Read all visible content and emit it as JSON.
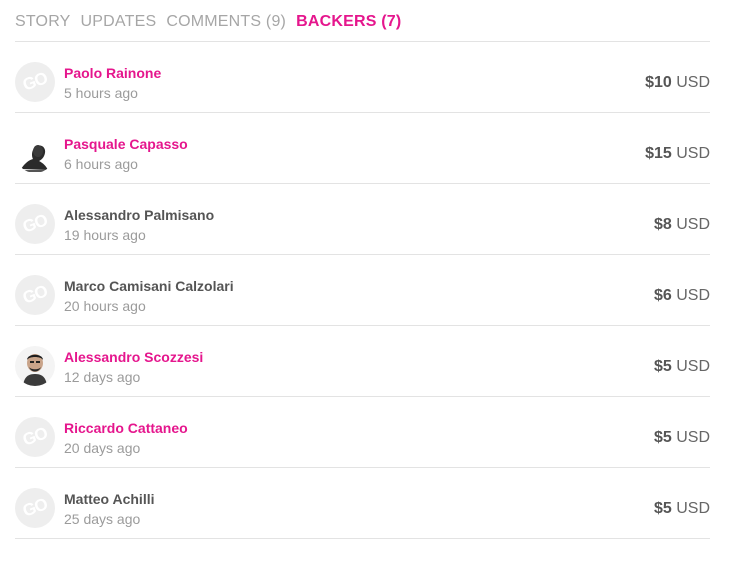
{
  "tabs": [
    {
      "label": "STORY",
      "active": false
    },
    {
      "label": "UPDATES",
      "active": false
    },
    {
      "label": "COMMENTS (9)",
      "active": false
    },
    {
      "label": "BACKERS (7)",
      "active": true
    }
  ],
  "colors": {
    "accent": "#e5168d",
    "muted": "#a6a6a6",
    "divider": "#e3e3e3"
  },
  "backers": [
    {
      "name": "Paolo Rainone",
      "time": "5 hours ago",
      "amount": "$10",
      "currency": "USD",
      "avatar": "go-default-icon",
      "linked": true
    },
    {
      "name": "Pasquale Capasso",
      "time": "6 hours ago",
      "amount": "$15",
      "currency": "USD",
      "avatar": "user-photo",
      "linked": true
    },
    {
      "name": "Alessandro Palmisano",
      "time": "19 hours ago",
      "amount": "$8",
      "currency": "USD",
      "avatar": "go-default-icon",
      "linked": false
    },
    {
      "name": "Marco Camisani Calzolari",
      "time": "20 hours ago",
      "amount": "$6",
      "currency": "USD",
      "avatar": "go-default-icon",
      "linked": false
    },
    {
      "name": "Alessandro Scozzesi",
      "time": "12 days ago",
      "amount": "$5",
      "currency": "USD",
      "avatar": "user-photo",
      "linked": true
    },
    {
      "name": "Riccardo Cattaneo",
      "time": "20 days ago",
      "amount": "$5",
      "currency": "USD",
      "avatar": "go-default-icon",
      "linked": true
    },
    {
      "name": "Matteo Achilli",
      "time": "25 days ago",
      "amount": "$5",
      "currency": "USD",
      "avatar": "go-default-icon",
      "linked": false
    }
  ]
}
